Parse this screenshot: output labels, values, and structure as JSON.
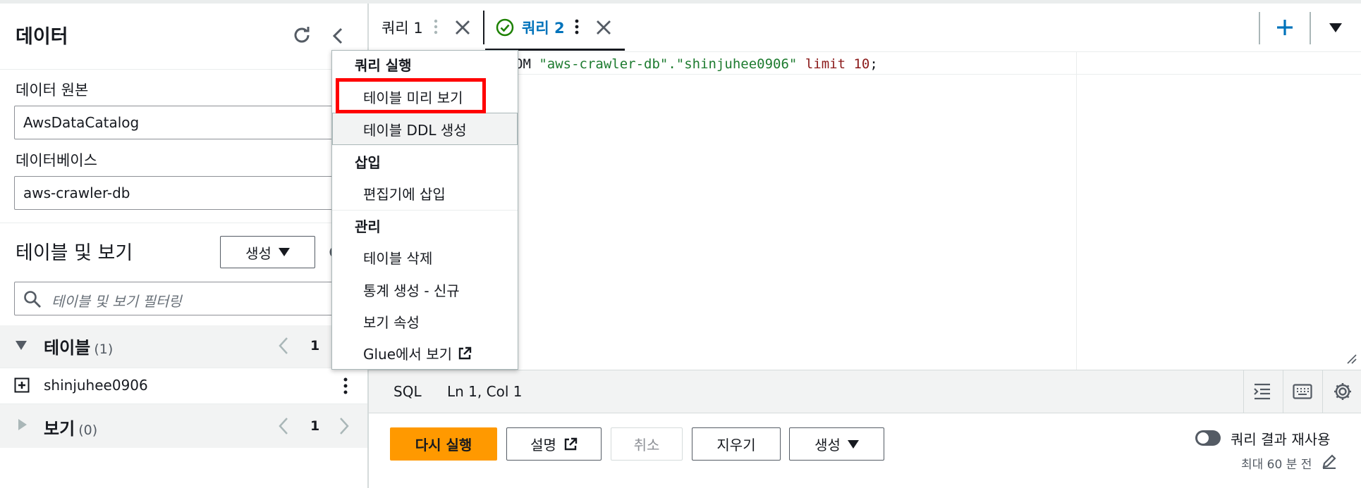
{
  "left_panel": {
    "title": "데이터",
    "data_source_label": "데이터 원본",
    "data_source_value": "AwsDataCatalog",
    "database_label": "데이터베이스",
    "database_value": "aws-crawler-db",
    "tables_views_title": "테이블 및 보기",
    "create_button": "생성",
    "filter_placeholder": "테이블 및 보기 필터링",
    "tables_section": {
      "label": "테이블",
      "count": "(1)",
      "page": "1"
    },
    "table_item": "shinjuhee0906",
    "views_section": {
      "label": "보기",
      "count": "(0)",
      "page": "1"
    }
  },
  "tabs": [
    {
      "label": "쿼리 1",
      "active": false
    },
    {
      "label": "쿼리 2",
      "active": true
    }
  ],
  "editor": {
    "code_prefix": "OM ",
    "code_string": "\"aws-crawler-db\".\"shinjuhee0906\"",
    "code_keyword": " limit ",
    "code_number": "10",
    "code_suffix": ";"
  },
  "status_bar": {
    "language": "SQL",
    "position": "Ln 1, Col 1"
  },
  "actions": {
    "run_again": "다시 실행",
    "explain": "설명",
    "cancel": "취소",
    "clear": "지우기",
    "create": "생성",
    "reuse_results": "쿼리 결과 재사용",
    "reuse_age": "최대 60 분 전"
  },
  "context_menu": {
    "group_run": "쿼리 실행",
    "preview_table": "테이블 미리 보기",
    "generate_ddl": "테이블 DDL 생성",
    "group_insert": "삽입",
    "insert_into_editor": "편집기에 삽입",
    "group_manage": "관리",
    "delete_table": "테이블 삭제",
    "generate_stats": "통계 생성 - 신규",
    "view_properties": "보기 속성",
    "view_in_glue": "Glue에서 보기"
  },
  "colors": {
    "accent_blue": "#0073bb",
    "primary_orange": "#ff9900",
    "success_green": "#1d8102",
    "highlight_red": "#ff0000"
  }
}
